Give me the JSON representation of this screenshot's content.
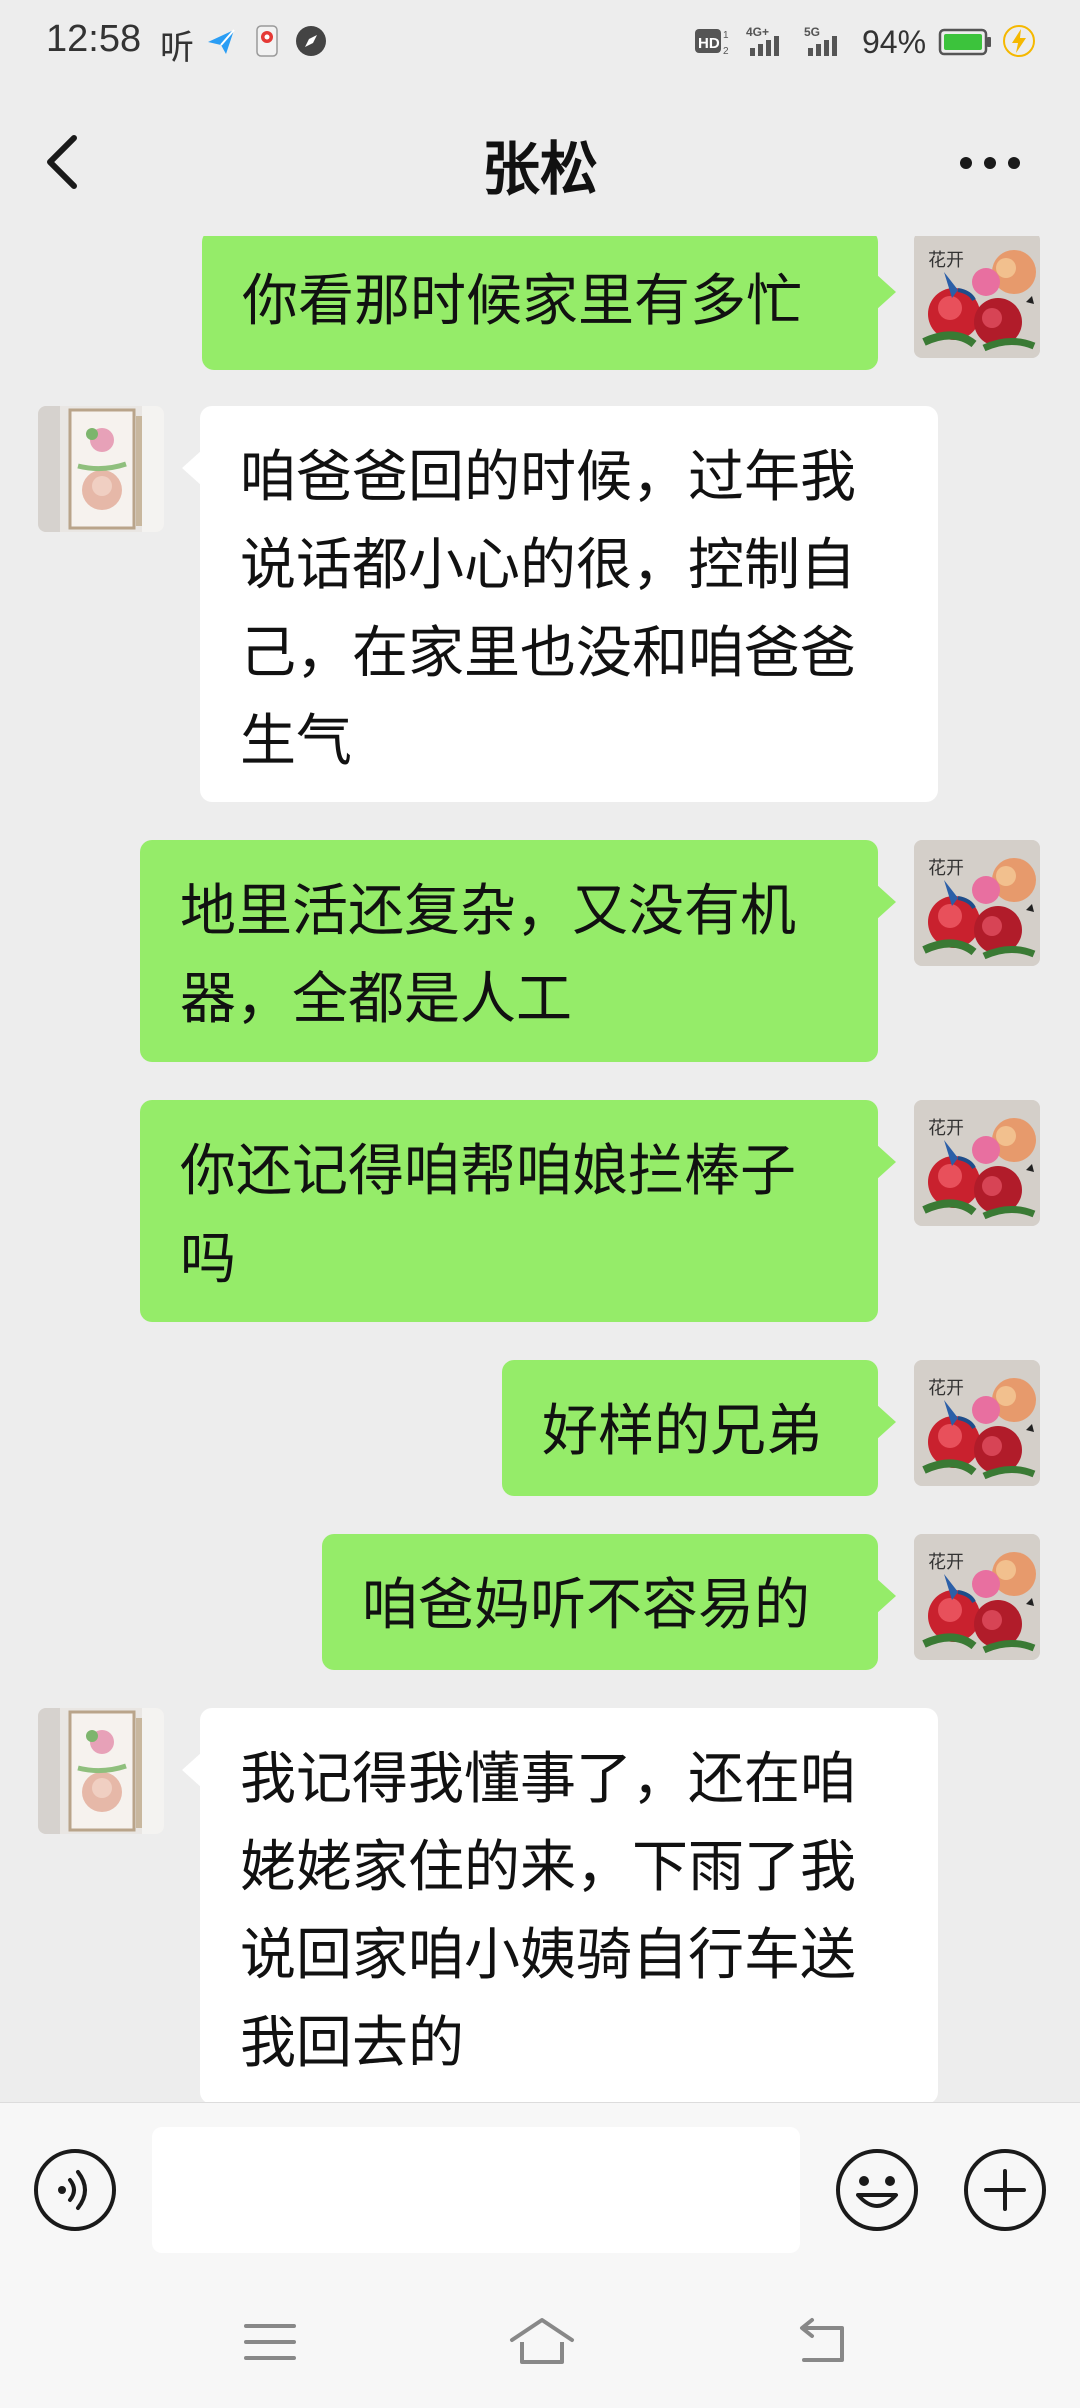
{
  "status_bar": {
    "time": "12:58",
    "app_indicator": "听",
    "network_hd": "HD",
    "network_4g": "4G+",
    "network_5g": "5G",
    "battery_percent": "94%",
    "icons": [
      "send-icon",
      "location-icon",
      "compass-icon",
      "hd-icon",
      "signal-4g-icon",
      "signal-5g-icon",
      "battery-icon",
      "charging-icon"
    ]
  },
  "header": {
    "back_icon": "chevron-left-icon",
    "title": "张松",
    "more_icon": "more-icon"
  },
  "messages": [
    {
      "side": "right",
      "text": "你看那时候家里有多忙"
    },
    {
      "side": "left",
      "text": "咱爸爸回的时候，过年我说话都小心的很，控制自己，在家里也没和咱爸爸生气"
    },
    {
      "side": "right",
      "text": "地里活还复杂，又没有机器，全都是人工"
    },
    {
      "side": "right",
      "text": "你还记得咱帮咱娘拦棒子吗"
    },
    {
      "side": "right",
      "text": "好样的兄弟"
    },
    {
      "side": "right",
      "text": "咱爸妈听不容易的"
    },
    {
      "side": "left",
      "text": "我记得我懂事了，还在咱姥姥家住的来，下雨了我说回家咱小姨骑自行车送我回去的"
    }
  ],
  "input_bar": {
    "value": "",
    "voice_icon": "voice-icon",
    "emoji_icon": "emoji-icon",
    "plus_icon": "plus-icon"
  },
  "system_nav": {
    "icons": [
      "menu-icon",
      "home-icon",
      "back-icon"
    ]
  },
  "colors": {
    "background": "#ededed",
    "sent_bubble": "#95ec69",
    "received_bubble": "#ffffff",
    "battery": "#3cc33c",
    "charging": "#f5b800"
  }
}
